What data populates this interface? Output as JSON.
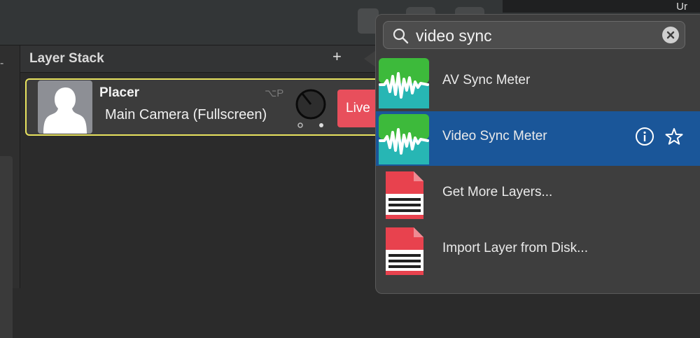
{
  "topbar": {
    "window_title_fragment": "Ur"
  },
  "layer_stack": {
    "title": "Layer Stack",
    "add_symbol": "+"
  },
  "layer": {
    "name": "Placer",
    "shortcut": "⌥P",
    "source": "Main Camera (Fullscreen)",
    "live_label": "Live",
    "border_color": "#e8e35f"
  },
  "left_strip": {
    "marker": "-"
  },
  "popover": {
    "search_value": "video sync",
    "results": [
      {
        "label": "AV Sync Meter",
        "icon": "waveform-icon"
      },
      {
        "label": "Video Sync Meter",
        "icon": "waveform-icon",
        "selected": true
      },
      {
        "label": "Get More Layers...",
        "icon": "document-icon"
      },
      {
        "label": "Import Layer from Disk...",
        "icon": "document-icon"
      }
    ]
  },
  "colors": {
    "accent_selected": "#1a5699",
    "live": "#e84f5c",
    "waveform_green": "#3dba3b",
    "waveform_teal": "#27b6b4",
    "document_red": "#e8424e"
  }
}
